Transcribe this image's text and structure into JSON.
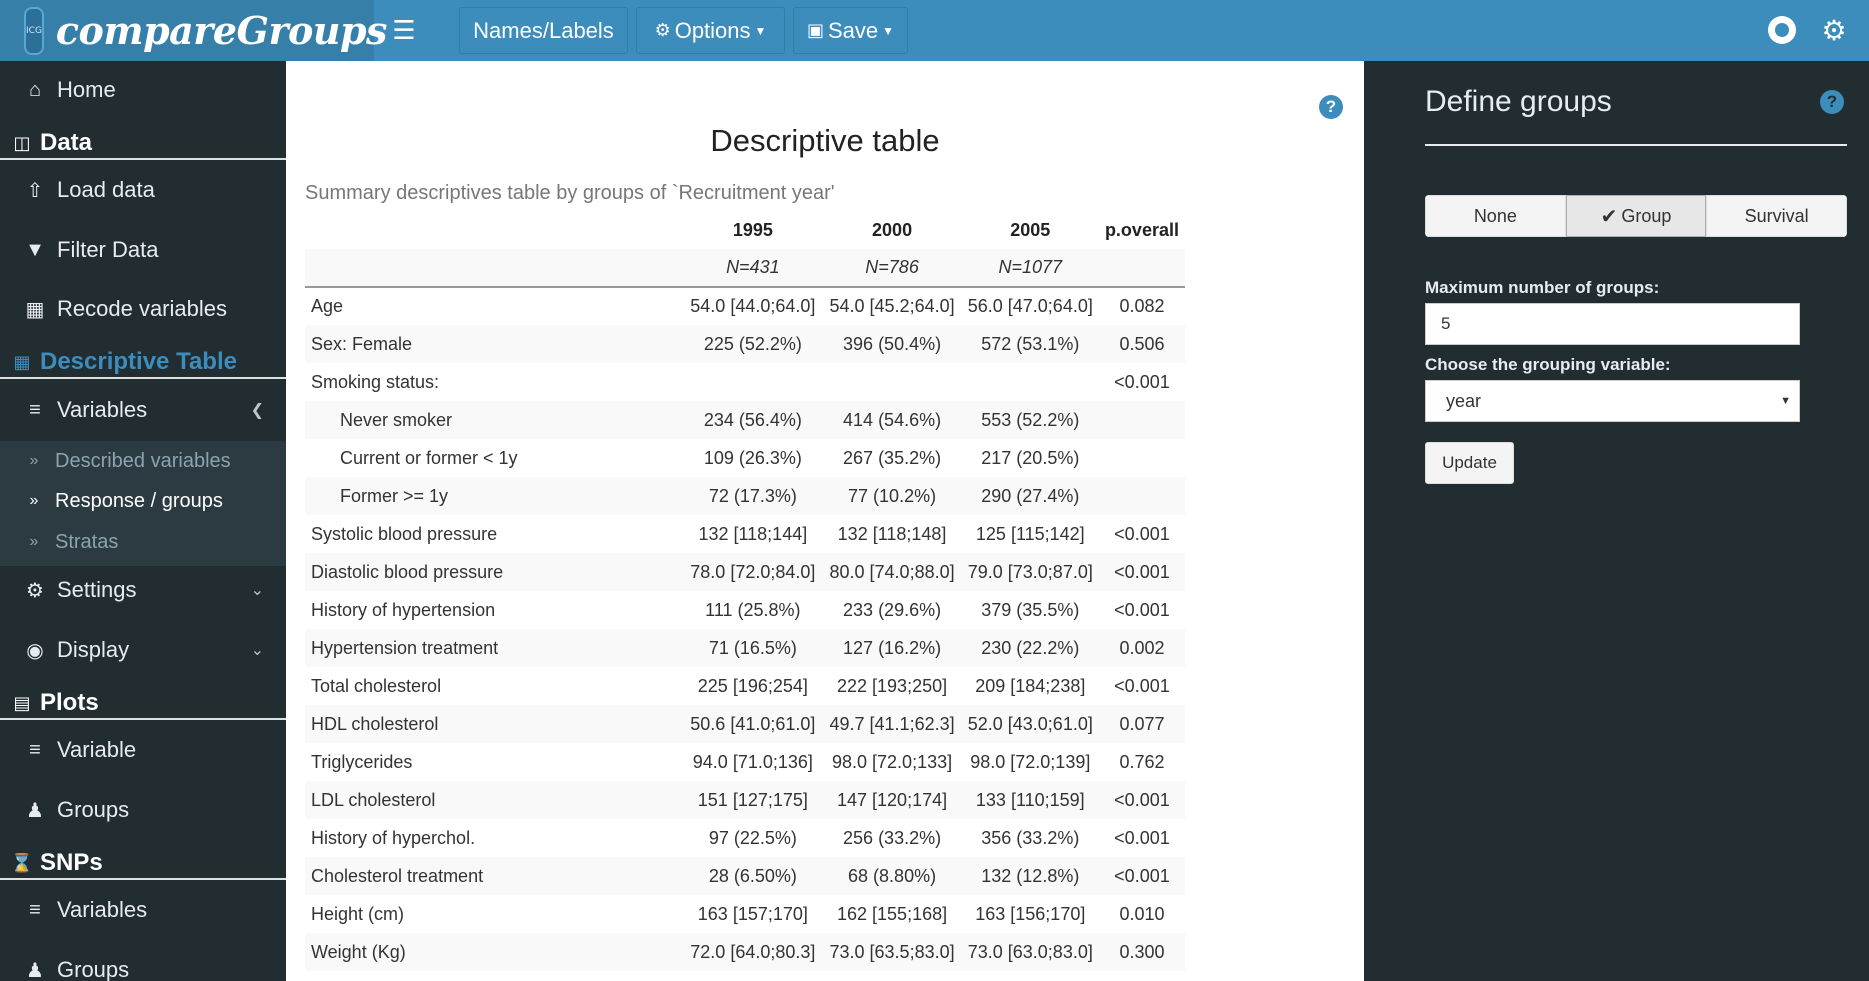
{
  "header": {
    "brand_title": "compareGroups",
    "logo_text": "ICG",
    "buttons": [
      {
        "label": "Names/Labels"
      },
      {
        "label": "Options"
      },
      {
        "label": "Save"
      }
    ],
    "icons": {
      "menu": "hamburger-icon",
      "github": "github-icon",
      "settings": "gears-icon"
    },
    "accent_color": "#3c8dbc"
  },
  "sidebar": {
    "home": "Home",
    "data_header": "Data",
    "load_data": "Load data",
    "filter_data": "Filter Data",
    "recode_variables": "Recode variables",
    "descriptive_header": "Descriptive Table",
    "variables": "Variables",
    "sub_items": [
      "Described variables",
      "Response / groups",
      "Stratas"
    ],
    "settings": "Settings",
    "display": "Display",
    "plots_header": "Plots",
    "plot_variable": "Variable",
    "plot_groups": "Groups",
    "snps_header": "SNPs",
    "snp_variables": "Variables",
    "snp_groups": "Groups"
  },
  "main": {
    "title": "Descriptive table",
    "subtitle": "Summary descriptives table by groups of `Recruitment year'",
    "columns": [
      "",
      "1995",
      "2000",
      "2005",
      "p.overall"
    ],
    "n_row": [
      "",
      "N=431",
      "N=786",
      "N=1077",
      ""
    ],
    "rows": [
      {
        "label": "Age",
        "indent": false,
        "v1995": "54.0 [44.0;64.0]",
        "v2000": "54.0 [45.2;64.0]",
        "v2005": "56.0 [47.0;64.0]",
        "p": "0.082"
      },
      {
        "label": "Sex: Female",
        "indent": false,
        "v1995": "225 (52.2%)",
        "v2000": "396 (50.4%)",
        "v2005": "572 (53.1%)",
        "p": "0.506"
      },
      {
        "label": "Smoking status:",
        "indent": false,
        "v1995": "",
        "v2000": "",
        "v2005": "",
        "p": "<0.001"
      },
      {
        "label": "Never smoker",
        "indent": true,
        "v1995": "234 (56.4%)",
        "v2000": "414 (54.6%)",
        "v2005": "553 (52.2%)",
        "p": ""
      },
      {
        "label": "Current or former < 1y",
        "indent": true,
        "v1995": "109 (26.3%)",
        "v2000": "267 (35.2%)",
        "v2005": "217 (20.5%)",
        "p": ""
      },
      {
        "label": "Former >= 1y",
        "indent": true,
        "v1995": "72 (17.3%)",
        "v2000": "77 (10.2%)",
        "v2005": "290 (27.4%)",
        "p": ""
      },
      {
        "label": "Systolic blood pressure",
        "indent": false,
        "v1995": "132 [118;144]",
        "v2000": "132 [118;148]",
        "v2005": "125 [115;142]",
        "p": "<0.001"
      },
      {
        "label": "Diastolic blood pressure",
        "indent": false,
        "v1995": "78.0 [72.0;84.0]",
        "v2000": "80.0 [74.0;88.0]",
        "v2005": "79.0 [73.0;87.0]",
        "p": "<0.001"
      },
      {
        "label": "History of hypertension",
        "indent": false,
        "v1995": "111 (25.8%)",
        "v2000": "233 (29.6%)",
        "v2005": "379 (35.5%)",
        "p": "<0.001"
      },
      {
        "label": "Hypertension treatment",
        "indent": false,
        "v1995": "71 (16.5%)",
        "v2000": "127 (16.2%)",
        "v2005": "230 (22.2%)",
        "p": "0.002"
      },
      {
        "label": "Total cholesterol",
        "indent": false,
        "v1995": "225 [196;254]",
        "v2000": "222 [193;250]",
        "v2005": "209 [184;238]",
        "p": "<0.001"
      },
      {
        "label": "HDL cholesterol",
        "indent": false,
        "v1995": "50.6 [41.0;61.0]",
        "v2000": "49.7 [41.1;62.3]",
        "v2005": "52.0 [43.0;61.0]",
        "p": "0.077"
      },
      {
        "label": "Triglycerides",
        "indent": false,
        "v1995": "94.0 [71.0;136]",
        "v2000": "98.0 [72.0;133]",
        "v2005": "98.0 [72.0;139]",
        "p": "0.762"
      },
      {
        "label": "LDL cholesterol",
        "indent": false,
        "v1995": "151 [127;175]",
        "v2000": "147 [120;174]",
        "v2005": "133 [110;159]",
        "p": "<0.001"
      },
      {
        "label": "History of hyperchol.",
        "indent": false,
        "v1995": "97 (22.5%)",
        "v2000": "256 (33.2%)",
        "v2005": "356 (33.2%)",
        "p": "<0.001"
      },
      {
        "label": "Cholesterol treatment",
        "indent": false,
        "v1995": "28 (6.50%)",
        "v2000": "68 (8.80%)",
        "v2005": "132 (12.8%)",
        "p": "<0.001"
      },
      {
        "label": "Height (cm)",
        "indent": false,
        "v1995": "163 [157;170]",
        "v2000": "162 [155;168]",
        "v2005": "163 [156;170]",
        "p": "0.010"
      },
      {
        "label": "Weight (Kg)",
        "indent": false,
        "v1995": "72.0 [64.0;80.3]",
        "v2000": "73.0 [63.5;83.0]",
        "v2005": "73.0 [63.0;83.0]",
        "p": "0.300"
      }
    ]
  },
  "right_panel": {
    "title": "Define groups",
    "segment_options": [
      "None",
      "Group",
      "Survival"
    ],
    "selected_option": "Group",
    "max_groups_label": "Maximum number of groups:",
    "max_groups_value": "5",
    "grouping_label": "Choose the grouping variable:",
    "grouping_value": "year",
    "update_label": "Update"
  }
}
